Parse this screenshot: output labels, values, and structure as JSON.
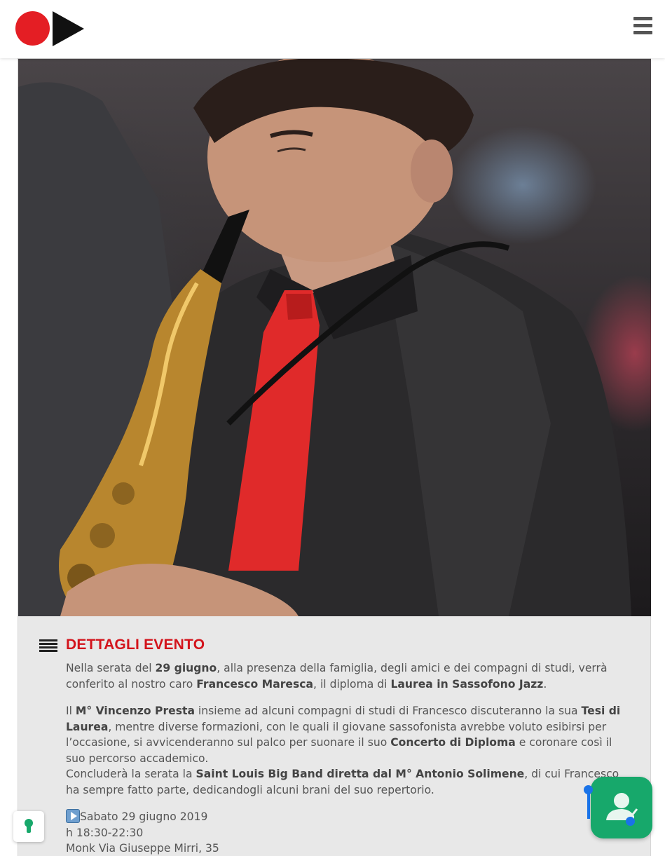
{
  "header": {
    "logo_colors": {
      "dot": "#e41e24",
      "play": "#111111"
    },
    "menu_icon": "hamburger-icon"
  },
  "event": {
    "image_alt": "Francesco Maresca suona il sassofono",
    "section_icon": "list-icon",
    "title": "DETTAGLI EVENTO",
    "p1": {
      "t1": "Nella serata del ",
      "b1": "29 giugno",
      "t2": ", alla presenza della famiglia, degli amici e dei compagni di studi, verrà conferito al nostro caro ",
      "b2": "Francesco Maresca",
      "t3": ", il diploma di ",
      "b3": "Laurea in Sassofono Jazz",
      "t4": "."
    },
    "p2": {
      "t1": "Il ",
      "b1": "M° Vincenzo Presta",
      "t2": " insieme ad alcuni compagni di studi di Francesco discuteranno la sua ",
      "b2": "Tesi di Laurea",
      "t3": ", mentre diverse formazioni, con le quali il giovane sassofonista avrebbe voluto esibirsi per l’occasione, si avvicenderanno sul palco per suonare il suo ",
      "b3": "Concerto di Diploma",
      "t4": " e coronare così il suo percorso accademico.",
      "t5": "Concluderà la serata la ",
      "b4": "Saint Louis Big Band diretta dal M° Antonio Solimene",
      "t6": ", di cui Francesco ha sempre fatto parte, dedicandogli alcuni brani del suo repertorio."
    },
    "info": {
      "date": "Sabato 29 giugno 2019",
      "time": "h 18:30-22:30",
      "venue": "Monk Via Giuseppe Mirri, 35"
    }
  },
  "floating": {
    "privacy_icon": "keyhole-icon",
    "contact_icon": "contact-user-icon",
    "accent": "#17a86b"
  }
}
